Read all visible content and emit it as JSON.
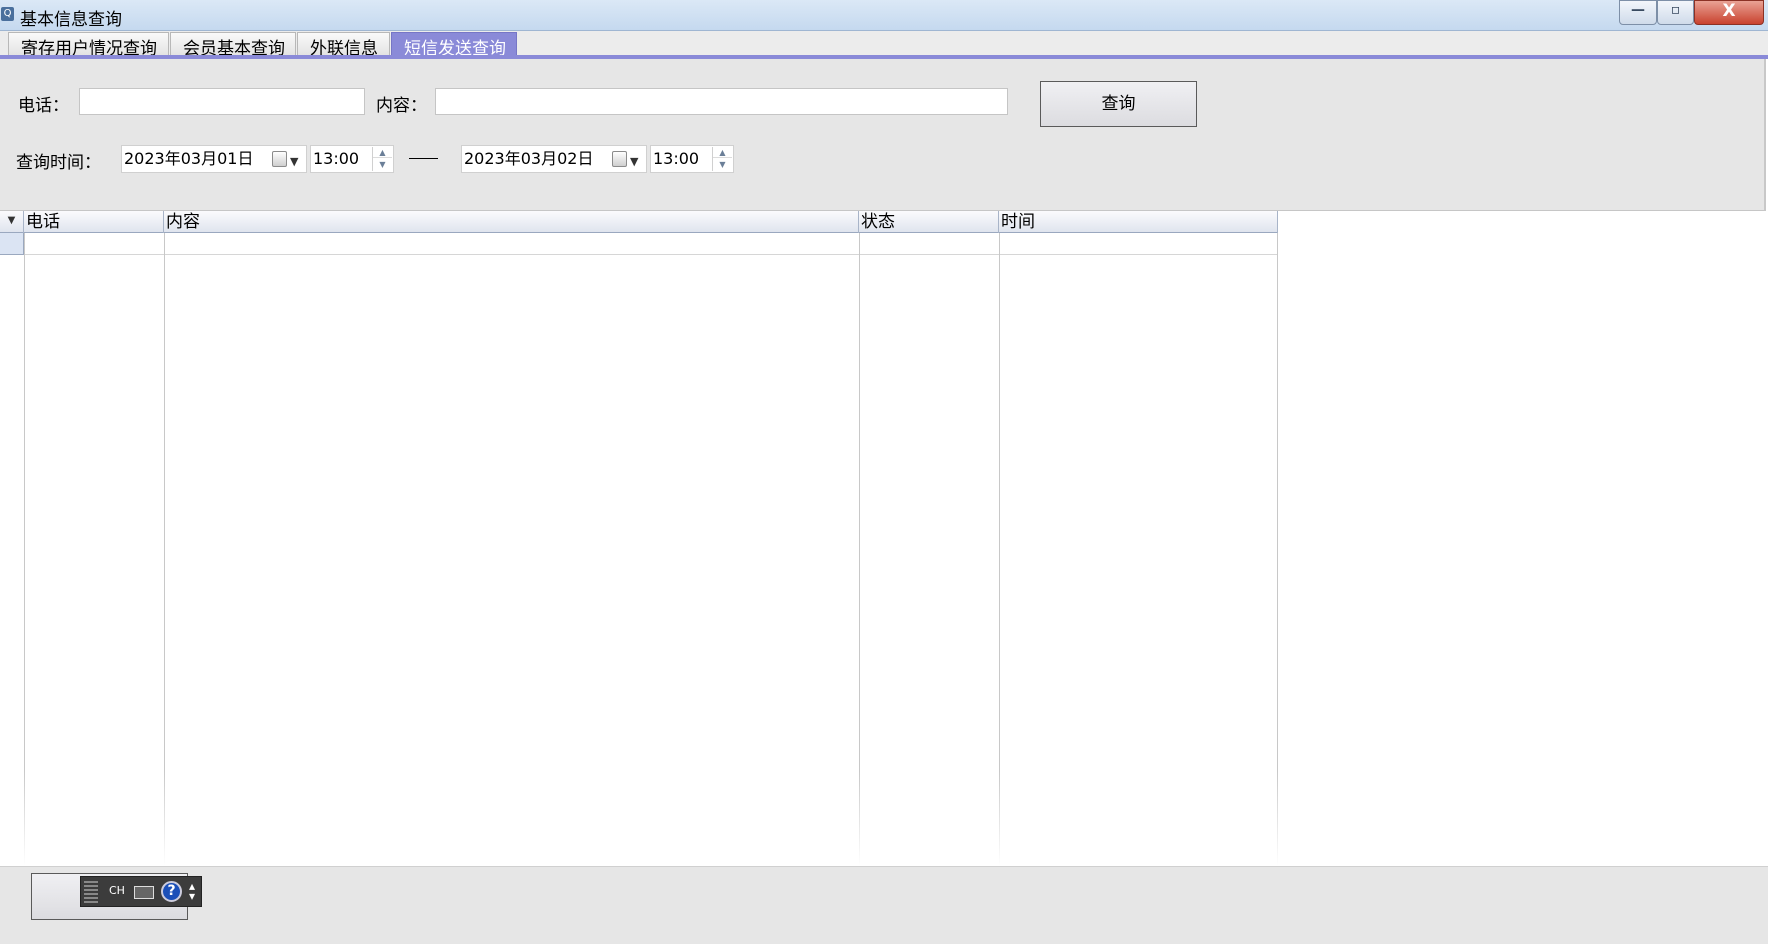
{
  "window": {
    "title": "基本信息查询",
    "minimize_symbol": "—",
    "maximize_symbol": "▫",
    "close_symbol": "X"
  },
  "tabs": [
    {
      "label": "寄存用户情况查询",
      "active": false
    },
    {
      "label": "会员基本查询",
      "active": false
    },
    {
      "label": "外联信息",
      "active": false
    },
    {
      "label": "短信发送查询",
      "active": true
    }
  ],
  "filters": {
    "phone_label": "电话：",
    "phone_value": "",
    "content_label": "内容：",
    "content_value": "",
    "query_button": "查询",
    "time_label": "查询时间：",
    "start_date": "2023年03月01日",
    "start_time": "13:00",
    "range_separator": "—",
    "end_date": "2023年03月02日",
    "end_time": "13:00"
  },
  "table": {
    "columns": [
      "电话",
      "内容",
      "状态",
      "时间"
    ],
    "rows": [
      [
        "",
        "",
        "",
        ""
      ]
    ]
  },
  "ime_toolbar": {
    "mode": "CH",
    "help": "?"
  },
  "colors": {
    "accent": "#8a8ad8",
    "panel_bg": "#e6e6e6",
    "titlebar": "#c5d9ef"
  }
}
